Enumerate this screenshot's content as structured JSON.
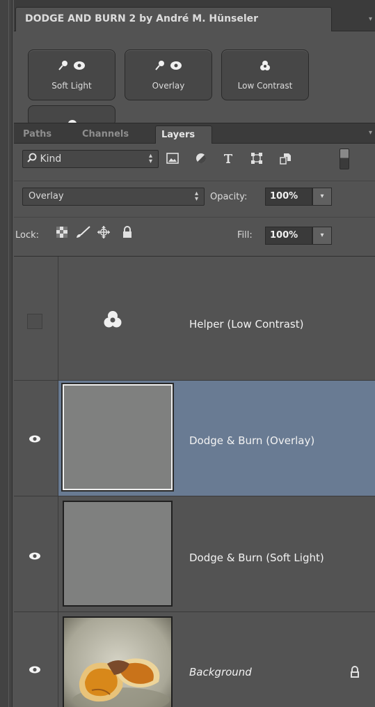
{
  "script_panel": {
    "title": "DODGE AND BURN 2 by André M. Hünseler",
    "menu_icon": "chevron-down-icon",
    "buttons": [
      {
        "label": "Soft Light",
        "icons": [
          "brush-icon",
          "eye-icon"
        ]
      },
      {
        "label": "Overlay",
        "icons": [
          "brush-icon",
          "eye-icon"
        ]
      },
      {
        "label": "Low Contrast",
        "icons": [
          "three-circles-icon"
        ]
      }
    ]
  },
  "tabs": {
    "paths": "Paths",
    "channels": "Channels",
    "layers": "Layers"
  },
  "filter": {
    "kind_label": "Kind",
    "icons": [
      "pixel-layer-filter-icon",
      "adjustment-layer-filter-icon",
      "type-layer-filter-icon",
      "shape-layer-filter-icon",
      "smart-object-filter-icon"
    ]
  },
  "blend": {
    "mode": "Overlay",
    "opacity_label": "Opacity:",
    "opacity_value": "100%"
  },
  "lock": {
    "label": "Lock:",
    "fill_label": "Fill:",
    "fill_value": "100%"
  },
  "layers": [
    {
      "name": "Helper (Low Contrast)",
      "visible": false,
      "selected": false
    },
    {
      "name": "Dodge & Burn (Overlay)",
      "visible": true,
      "selected": true
    },
    {
      "name": "Dodge & Burn (Soft Light)",
      "visible": true,
      "selected": false
    },
    {
      "name": "Background",
      "visible": true,
      "selected": false,
      "locked": true
    }
  ],
  "colors": {
    "panel_bg": "#535353",
    "selected_row": "#697b93",
    "gray_fill": "#7f807f"
  }
}
